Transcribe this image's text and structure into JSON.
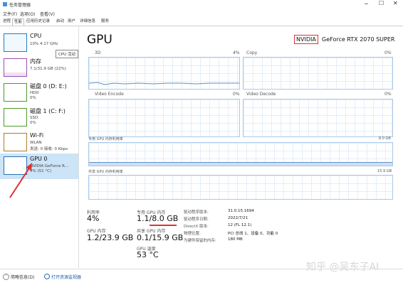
{
  "window": {
    "title": "任务管理器"
  },
  "menu": [
    "文件(F)",
    "选项(O)",
    "查看(V)"
  ],
  "tabs": [
    "进程",
    "性能",
    "应用历史记录",
    "启动",
    "用户",
    "详细信息",
    "服务"
  ],
  "sidebar": [
    {
      "name": "CPU",
      "sub1": "10% 4.17 GHz",
      "sub2": ""
    },
    {
      "name": "内存",
      "sub1": "7.1/31.9 GB (22%)",
      "sub2": ""
    },
    {
      "name": "磁盘 0 (D: E:)",
      "sub1": "HDD",
      "sub2": "0%"
    },
    {
      "name": "磁盘 1 (C: F:)",
      "sub1": "SSD",
      "sub2": "0%"
    },
    {
      "name": "Wi-Fi",
      "sub1": "WLAN",
      "sub2": "发送: 0 接收: 0 Kbps"
    },
    {
      "name": "GPU 0",
      "sub1": "NVIDIA GeForce R...",
      "sub2": "4% (51 °C)"
    }
  ],
  "tooltip": "CPU 活动",
  "main": {
    "title": "GPU",
    "model_vendor": "NVIDIA",
    "model_name": "GeForce RTX 2070 SUPER",
    "engines": [
      {
        "name": "3D",
        "pct": "4%"
      },
      {
        "name": "Copy",
        "pct": "0%"
      },
      {
        "name": "Video Encode",
        "pct": "0%"
      },
      {
        "name": "Video Decode",
        "pct": "0%"
      }
    ],
    "dedicated_label": "专用 GPU 内存利用率",
    "dedicated_max": "8.0 GB",
    "shared_label": "共享 GPU 内存利用率",
    "shared_max": "15.9 GB",
    "stats": {
      "util_label": "利用率",
      "util_value": "4%",
      "dedicated_label": "专用 GPU 内存",
      "dedicated_value": "1.1/8.0 GB",
      "gpu_mem_label": "GPU 内存",
      "gpu_mem_value": "1.2/23.9 GB",
      "shared_label": "共享 GPU 内存",
      "shared_value": "0.1/15.9 GB",
      "temp_label": "GPU 温度",
      "temp_value": "53 °C"
    },
    "info": [
      {
        "k": "驱动程序版本:",
        "v": "31.0.15.1694"
      },
      {
        "k": "驱动程序日期:",
        "v": "2022/7/21"
      },
      {
        "k": "DirectX 版本:",
        "v": "12 (FL 12.1)"
      },
      {
        "k": "物理位置:",
        "v": "PCI 总线 1、设备 0、功能 0"
      },
      {
        "k": "为硬件保留的内存:",
        "v": "180 MB"
      }
    ]
  },
  "footer": {
    "less": "简略信息(D)",
    "monitor": "打开资源监视器"
  },
  "watermark": "知乎 @吴东子AI",
  "colors": {
    "gpu_line": "#5a8fc9",
    "accent_red": "#d33"
  }
}
